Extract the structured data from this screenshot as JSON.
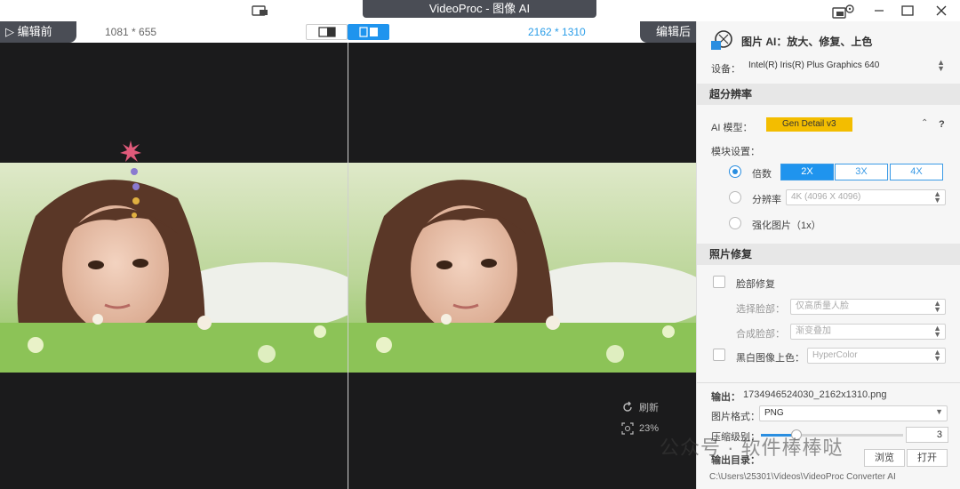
{
  "window": {
    "title": "VideoProc - 图像 AI"
  },
  "compare": {
    "before_label": "编辑前",
    "after_label": "编辑后",
    "before_resolution": "1081 * 655",
    "after_resolution": "2162 * 1310"
  },
  "preview_tools": {
    "refresh_label": "刷新",
    "zoom_level": "23%"
  },
  "panel": {
    "title": "图片 AI：放大、修复、上色",
    "device_label": "设备：",
    "device_value": "Intel(R) Iris(R) Plus Graphics 640",
    "super_res": {
      "heading": "超分辨率",
      "model_label": "AI 模型：",
      "model_value": "Gen Detail v3",
      "help": "?",
      "block_label": "模块设置：",
      "scale_label": "倍数",
      "scale_options": [
        "2X",
        "3X",
        "4X"
      ],
      "resolution_label": "分辨率",
      "resolution_value": "4K (4096 X 4096)",
      "enhance_label": "强化图片（1x）"
    },
    "repair": {
      "heading": "照片修复",
      "face_label": "脸部修复",
      "select_face_label": "选择脸部：",
      "select_face_value": "仅高质量人脸",
      "blend_label": "合成脸部：",
      "blend_value": "渐变叠加",
      "colorize_label": "黑白图像上色：",
      "colorize_value": "HyperColor"
    },
    "output": {
      "output_label": "输出：",
      "output_file": "1734946524030_2162x1310.png",
      "format_label": "图片格式：",
      "format_value": "PNG",
      "compression_label": "压缩级别：",
      "compression_value": "3",
      "compression_fraction": 0.25,
      "dir_label": "输出目录：",
      "browse_label": "浏览",
      "open_label": "打开",
      "dir_path": "C:\\Users\\25301\\Videos\\VideoProc Converter AI"
    }
  },
  "watermark": "公众号 · 软件棒棒哒",
  "colors": {
    "accent": "#1f94ee",
    "model_pill": "#f3bd00",
    "dark_bar": "#4a4d55",
    "preview_bg": "#1b1b1c"
  }
}
